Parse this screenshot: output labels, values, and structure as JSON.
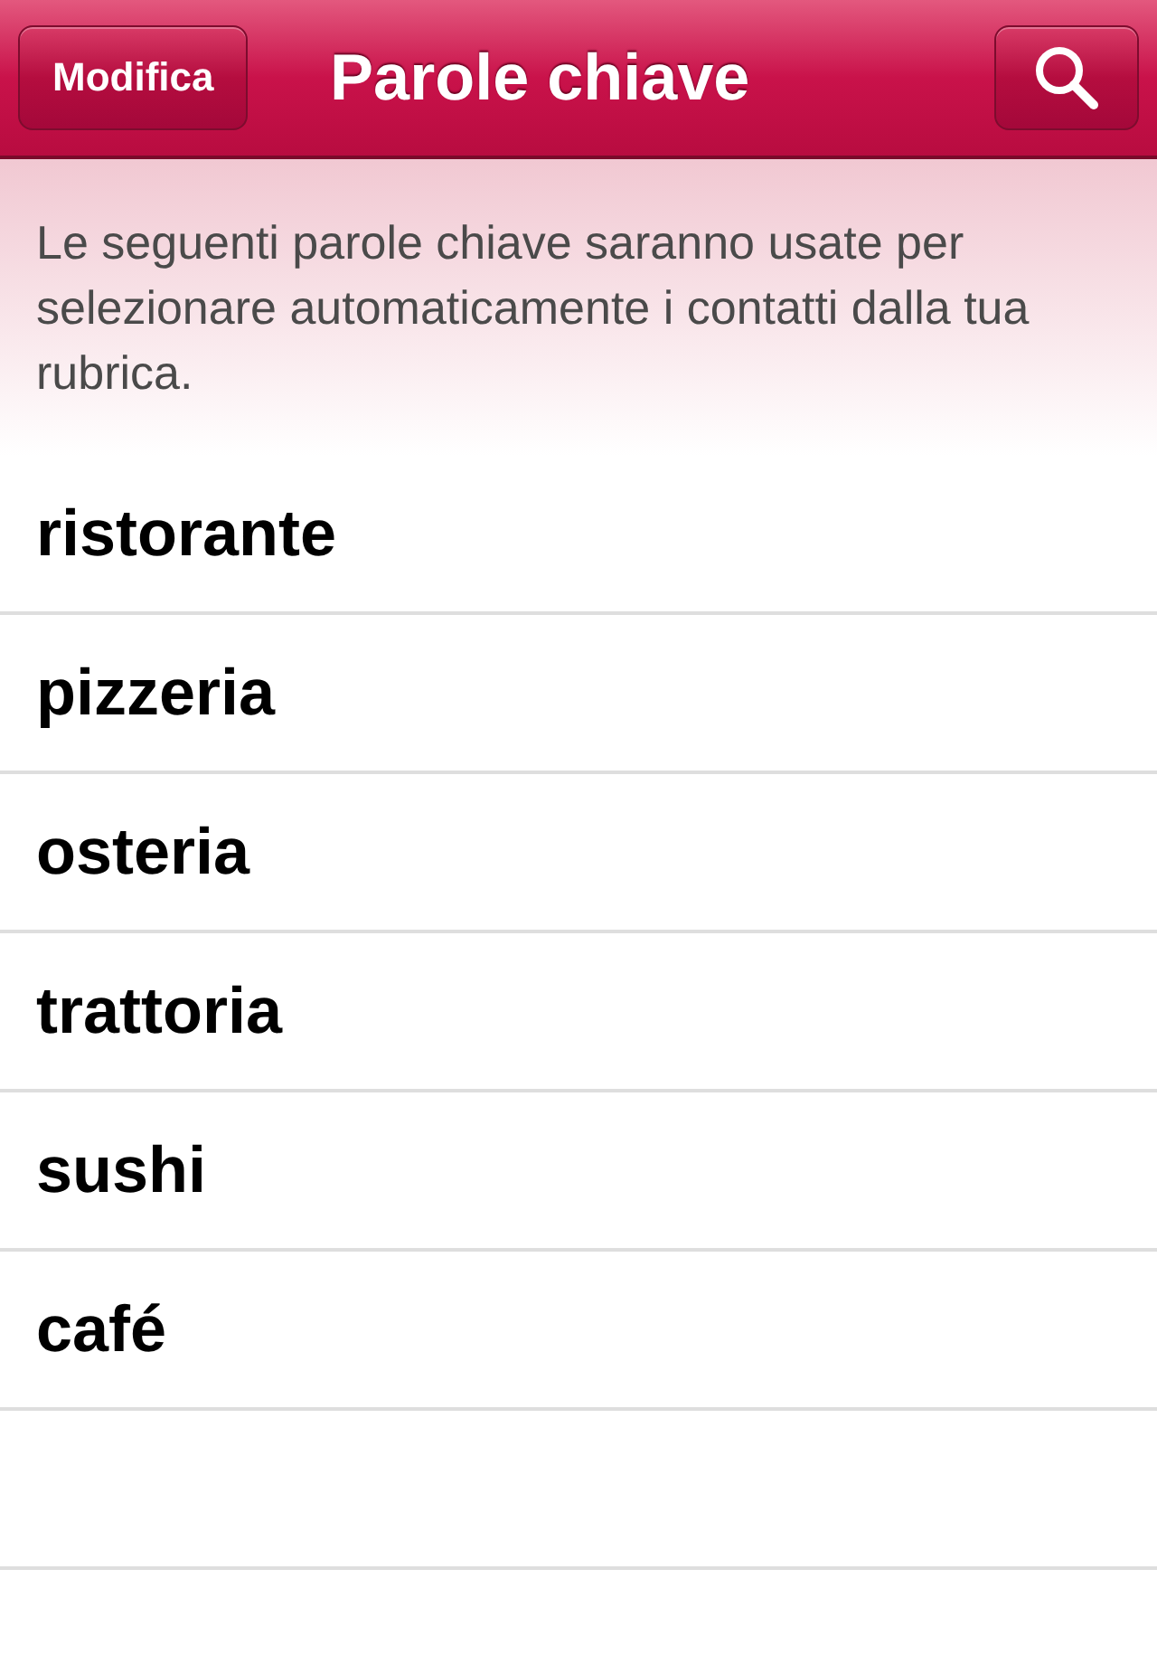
{
  "nav_bar": {
    "title": "Parole chiave",
    "edit_button": "Modifica"
  },
  "description": "Le seguenti parole chiave saranno usate per selezionare automaticamente i contatti dalla tua rubrica.",
  "keywords": [
    {
      "label": "ristorante"
    },
    {
      "label": "pizzeria"
    },
    {
      "label": "osteria"
    },
    {
      "label": "trattoria"
    },
    {
      "label": "sushi"
    },
    {
      "label": "café"
    }
  ]
}
